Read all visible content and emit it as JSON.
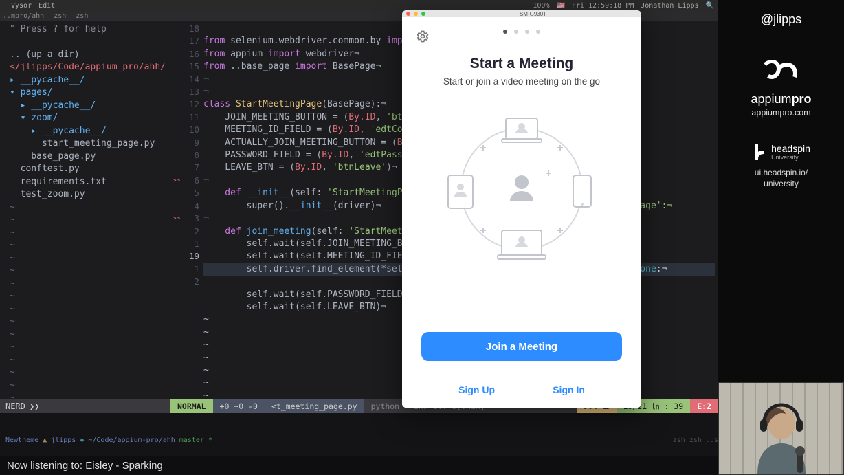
{
  "menubar": {
    "app": "Vysor",
    "menu1": "Edit",
    "wifi": "⚡︎",
    "battery": "100%",
    "flag": "🇺🇸",
    "time": "Fri 12:59:18 PM",
    "user": "Jonathan Lipps",
    "search": "🔍"
  },
  "terminal_tabs": {
    "t1": "..mpro/ahh",
    "t2": "zsh",
    "t3": "zsh"
  },
  "tree": {
    "hint": "\" Press ? for help",
    "up": ".. (up a dir)",
    "path": "</jlipps/Code/appium_pro/ahh/",
    "items": [
      "▸ __pycache__/",
      "▾ pages/",
      "  ▸ __pycache__/",
      "  ▾ zoom/",
      "    ▸ __pycache__/",
      "      start_meeting_page.py",
      "    base_page.py",
      "  conftest.py",
      "  requirements.txt",
      "  test_zoom.py"
    ],
    "status_left": "NERD",
    "tilde": "~"
  },
  "code": {
    "lnums": [
      "18",
      "17",
      "16",
      "15",
      "14",
      "13",
      "12",
      "11",
      "10",
      "9",
      "8",
      "7",
      "6",
      "5",
      "4",
      "3",
      "2",
      "1",
      "19",
      "1",
      "2"
    ],
    "bp_rows": [
      12,
      15
    ],
    "l1_a": "from ",
    "l1_b": "selenium.webdriver.common.by ",
    "l1_c": "imp",
    "l2_a": "from ",
    "l2_b": "appium ",
    "l2_c": "import ",
    "l2_d": "webdriver¬",
    "l3_a": "from ",
    "l3_b": "..base_page ",
    "l3_c": "import ",
    "l3_d": "BasePage¬",
    "l4": "¬",
    "l5": "¬",
    "l6_a": "class ",
    "l6_b": "StartMeetingPage",
    "l6_c": "(BasePage):¬",
    "l7_a": "    JOIN_MEETING_BUTTON = (",
    "l7_b": "By.ID",
    "l7_c": ", ",
    "l7_d": "'bt",
    "l8_a": "    MEETING_ID_FIELD = (",
    "l8_b": "By.ID",
    "l8_c": ", ",
    "l8_d": "'edtCo",
    "l9_a": "    ACTUALLY_JOIN_MEETING_BUTTON = (",
    "l9_b": "B",
    "l10_a": "    PASSWORD_FIELD = (",
    "l10_b": "By.ID",
    "l10_c": ", ",
    "l10_d": "'edtPass",
    "l11_a": "    LEAVE_BTN = (",
    "l11_b": "By.ID",
    "l11_c": ", ",
    "l11_d": "'btnLeave'",
    "l11_e": ")¬",
    "l12": "¬",
    "l13_a": "    def ",
    "l13_b": "__init__",
    "l13_c": "(self: ",
    "l13_d": "'StartMeetingP",
    "l14_a": "        super().",
    "l14_b": "__init__",
    "l14_c": "(driver)¬",
    "l15": "¬",
    "l16_a": "    def ",
    "l16_b": "join_meeting",
    "l16_c": "(self: ",
    "l16_d": "'StartMeet",
    "l17": "        self.wait(self.JOIN_MEETING_B",
    "l18": "        self.wait(self.MEETING_ID_FIE",
    "l19": "        self.driver.find_element(*sel",
    "l20": "        self.wait(self.PASSWORD_FIELD",
    "l21": "        self.wait(self.LEAVE_BTN)¬",
    "r1": "ingPage':¬",
    "r2": "→  None:¬"
  },
  "status": {
    "mode": "NORMAL",
    "pos": "+0 ~0 -0",
    "file": "<t_meeting_page.py",
    "git": "python « ahh   utf-8[unix]",
    "pct": "90% ☰",
    "rc": "19/21 ㏑ : 39",
    "err": "E:2"
  },
  "shell": {
    "theme": "Newtheme",
    "user": "jlipps",
    "cwd": "~/Code/appium-pro/ahh",
    "branch": "master *",
    "trail": "zsh  zsh  ..s"
  },
  "nowplaying": "Now listening to: Eisley - Sparking",
  "device": {
    "window_title": "SM-G930T",
    "title": "Start a Meeting",
    "subtitle": "Start or join a video meeting on the go",
    "primary": "Join a Meeting",
    "signup": "Sign Up",
    "signin": "Sign In"
  },
  "overlay": {
    "handle": "@jlipps",
    "brand_a": "appium",
    "brand_b": "pro",
    "site": "appiumpro.com",
    "hs_name": "headspin",
    "hs_sub": "University",
    "hs_url": "ui.headspin.io/\nuniversity"
  }
}
